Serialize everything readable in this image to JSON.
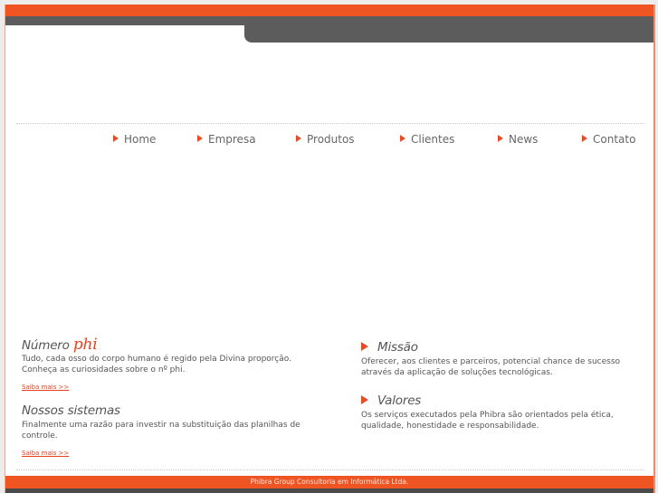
{
  "nav": {
    "items": [
      {
        "label": "Home"
      },
      {
        "label": "Empresa"
      },
      {
        "label": "Produtos"
      },
      {
        "label": "Clientes"
      },
      {
        "label": "News"
      },
      {
        "label": "Contato"
      }
    ]
  },
  "left": {
    "phi": {
      "title_prefix": "Número",
      "title_accent": "phi",
      "text": "Tudo, cada osso do corpo humano é regido pela Divina proporção. Conheça as curiosidades sobre o nº phi.",
      "link": "Saiba mais >>"
    },
    "sistemas": {
      "title": "Nossos sistemas",
      "text": "Finalmente uma razão para investir na substituição das planilhas de controle.",
      "link": "Saiba mais >>"
    }
  },
  "right": {
    "missao": {
      "title": "Missão",
      "text": "Oferecer, aos clientes e parceiros, potencial chance de sucesso através da aplicação de soluções tecnológicas."
    },
    "valores": {
      "title": "Valores",
      "text": "Os serviços executados pela Phibra são orientados pela ética, qualidade, honestidade e responsabilidade."
    }
  },
  "footer": {
    "text": "Phibra Group Consultoria em Informática Ltda."
  },
  "colors": {
    "accent": "#ef5423",
    "dark": "#5b5c5b"
  }
}
